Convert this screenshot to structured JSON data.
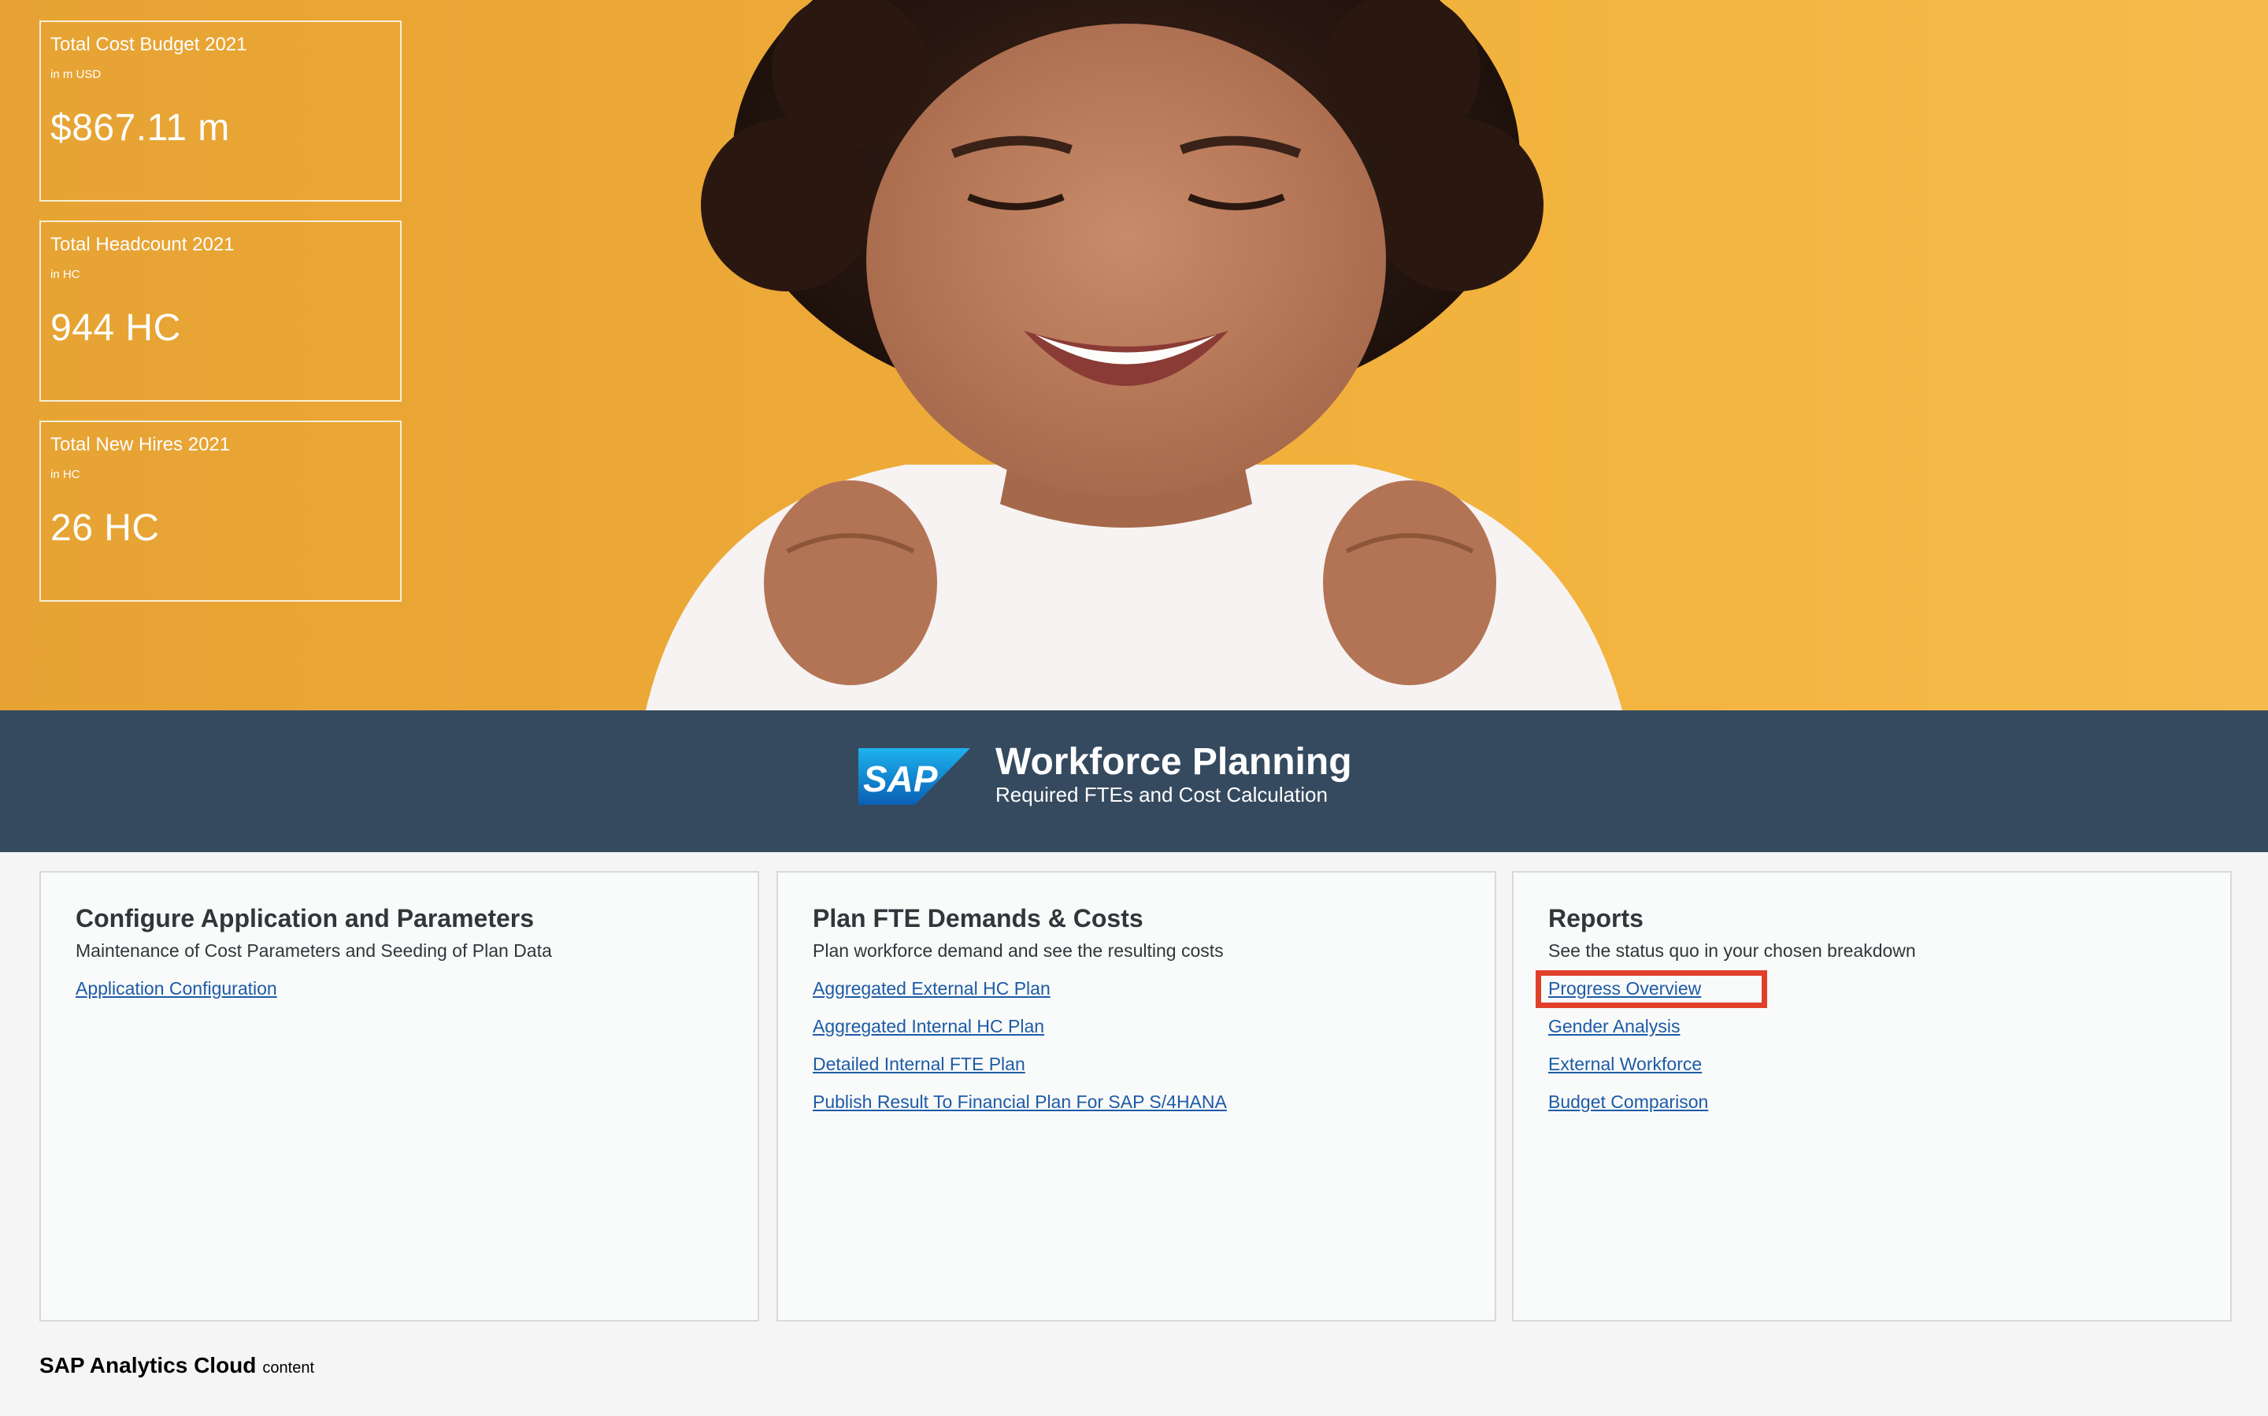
{
  "kpis": [
    {
      "title": "Total Cost Budget 2021",
      "unit": "in m USD",
      "value": "$867.11 m"
    },
    {
      "title": "Total Headcount 2021",
      "unit": "in HC",
      "value": "944 HC"
    },
    {
      "title": "Total New Hires 2021",
      "unit": "in HC",
      "value": "26 HC"
    }
  ],
  "banner": {
    "logo_text": "SAP",
    "title": "Workforce Planning",
    "subtitle": "Required FTEs and Cost Calculation"
  },
  "tiles": [
    {
      "title": "Configure Application and Parameters",
      "description": "Maintenance of Cost Parameters and Seeding of Plan Data",
      "links": [
        "Application Configuration"
      ]
    },
    {
      "title": "Plan FTE Demands & Costs",
      "description": "Plan workforce demand and see the resulting costs",
      "links": [
        "Aggregated External HC Plan",
        "Aggregated Internal HC Plan",
        "Detailed Internal FTE Plan",
        "Publish Result To Financial Plan For SAP S/4HANA"
      ]
    },
    {
      "title": "Reports",
      "description": "See the status quo in your chosen breakdown",
      "links": [
        "Progress Overview",
        "Gender Analysis",
        "External Workforce",
        "Budget Comparison"
      ]
    }
  ],
  "footer": {
    "brand": "SAP Analytics Cloud",
    "suffix": "content"
  },
  "colors": {
    "hero_background": "#eeaa38",
    "banner_background": "#354a5f",
    "link": "#1d5ba6",
    "highlight": "#e0402a"
  }
}
